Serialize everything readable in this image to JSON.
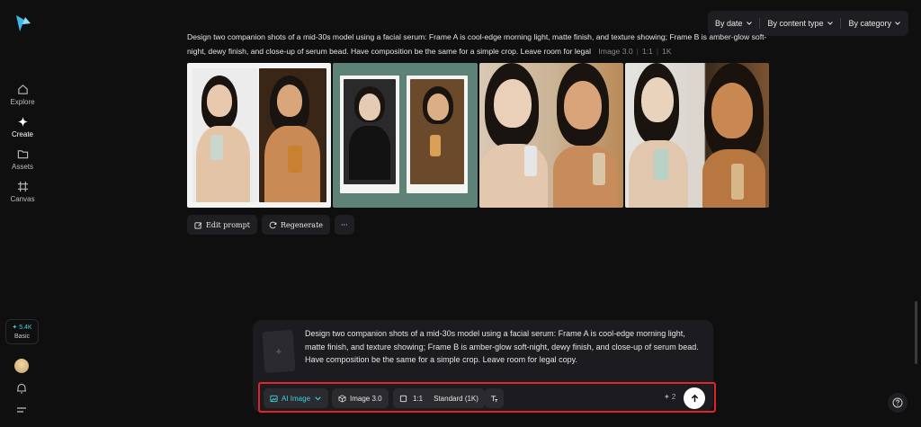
{
  "sidebar": {
    "nav": [
      {
        "label": "Explore",
        "icon": "home-icon"
      },
      {
        "label": "Create",
        "icon": "sparkle-icon"
      },
      {
        "label": "Assets",
        "icon": "folder-icon"
      },
      {
        "label": "Canvas",
        "icon": "frame-icon"
      }
    ],
    "credits": {
      "amount": "✦ 5.4K",
      "plan": "Basic"
    }
  },
  "filters": {
    "by_date": "By date",
    "by_content_type": "By content type",
    "by_category": "By category"
  },
  "generation": {
    "prompt": "Design two companion shots of a mid-30s model using a facial serum: Frame A is cool-edge morning light, matte finish, and texture showing; Frame B is amber-glow soft-night, dewy finish, and close-up of serum bead. Have composition be the same for a simple crop. Leave room for legal",
    "model": "Image 3.0",
    "ratio": "1:1",
    "resolution": "1K",
    "images": [
      "image-1",
      "image-2",
      "image-3",
      "image-4"
    ]
  },
  "actions": {
    "edit_prompt": "Edit prompt",
    "regenerate": "Regenerate",
    "more": "···"
  },
  "composer": {
    "text": "Design two companion shots of a mid-30s model using a facial serum: Frame A is cool-edge morning light, matte finish, and texture showing; Frame B is amber-glow soft-night, dewy finish, and close-up of serum bead. Have composition be the same for a simple crop. Leave room for legal copy.",
    "mode": "AI Image",
    "model": "Image 3.0",
    "ratio": "1:1",
    "quality": "Standard (1K)",
    "cost": "✦ 2"
  },
  "colors": {
    "accent": "#3fd1e0",
    "background": "#0f0f10",
    "highlight_border": "#e0242d"
  }
}
